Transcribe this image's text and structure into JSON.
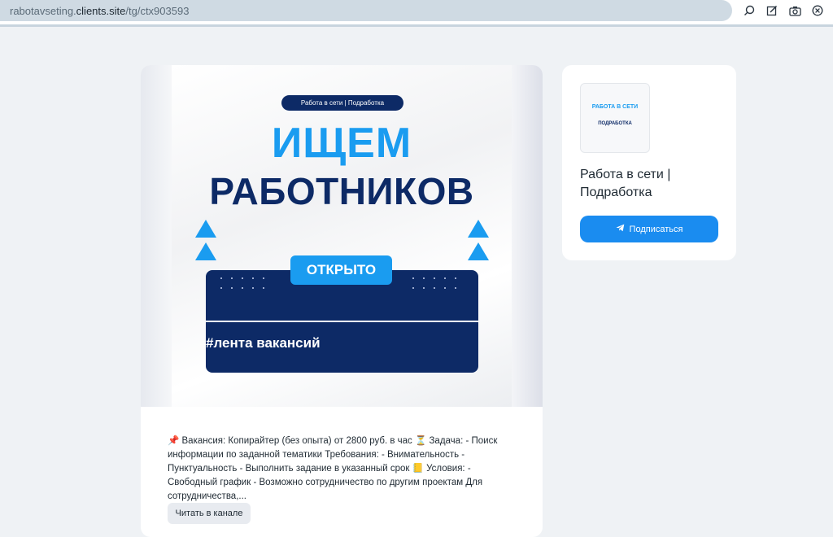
{
  "address_bar": {
    "url_prefix": "rabotavseting.",
    "url_host": "clients.site",
    "url_path": "/tg/ctx903593"
  },
  "toolbar_icons": [
    "search-icon",
    "edit-icon",
    "camera-icon",
    "close-icon"
  ],
  "post": {
    "banner": {
      "pill_label": "Работа в сети | Подработка",
      "headline_1": "ИЩЕМ",
      "headline_2": "РАБОТНИКОВ",
      "badge": "ОТКРЫТО",
      "hashtag": "#лента вакансий"
    },
    "description": "📌 Вакансия: Копирайтер (без опыта) от 2800 руб. в час ⏳ Задача: - Поиск информации по заданной тематики Требования: - Внимательность - Пунктуальность - Выполнить задание в указанный срок 📒 Условия: - Свободный график - Возможно сотрудничество по другим проектам Для сотрудничества,...",
    "read_button": "Читать в канале"
  },
  "channel": {
    "logo_text_1": "РАБОТА В СЕТИ",
    "logo_text_2": "ПОДРАБОТКА",
    "title": "Работа в сети | Подработка",
    "subscribe_button": "Подписаться"
  },
  "colors": {
    "accent_blue": "#1a9cf0",
    "navy": "#0d2a66",
    "page_bg": "#eff2f5"
  }
}
